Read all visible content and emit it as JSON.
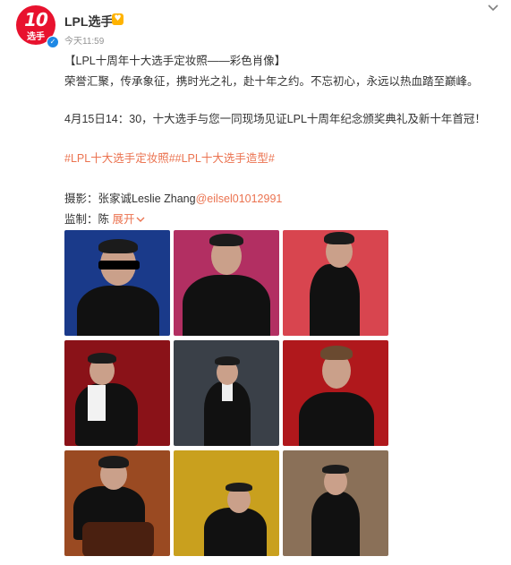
{
  "account": {
    "avatar_text": "10",
    "avatar_sub": "选手",
    "name": "LPL选手",
    "badge": "♥",
    "verified_mark": "✓",
    "time": "今天11:59",
    "more_icon": "chevron-down"
  },
  "post": {
    "title": "【LPL十周年十大选手定妆照——彩色肖像】",
    "line1": "荣誉汇聚，传承象征，携时光之礼，赴十年之约。不忘初心，永远以热血踏至巅峰。",
    "line2": "4月15日14：30，十大选手与您一同现场见证LPL十周年纪念颁奖典礼及新十年首冠！",
    "hashtag1": "#LPL十大选手定妆照#",
    "hashtag2": "#LPL十大选手造型#",
    "photographer_label": "摄影：张家诚Leslie Zhang",
    "photographer_link": "@eilsel01012991",
    "supervisor_label": "监制：陈",
    "expand": "展开"
  },
  "photos": [
    {
      "bg": "#1a3a8a"
    },
    {
      "bg": "#b22f62"
    },
    {
      "bg": "#d8454f"
    },
    {
      "bg": "#8a1218"
    },
    {
      "bg": "#3a4048"
    },
    {
      "bg": "#b0181c"
    },
    {
      "bg": "#9a4a22"
    },
    {
      "bg": "#c9a01e"
    },
    {
      "bg": "#8a7058"
    }
  ],
  "colors": {
    "link": "#eb7350",
    "brand": "#e8122e",
    "verified": "#1e88e5"
  }
}
